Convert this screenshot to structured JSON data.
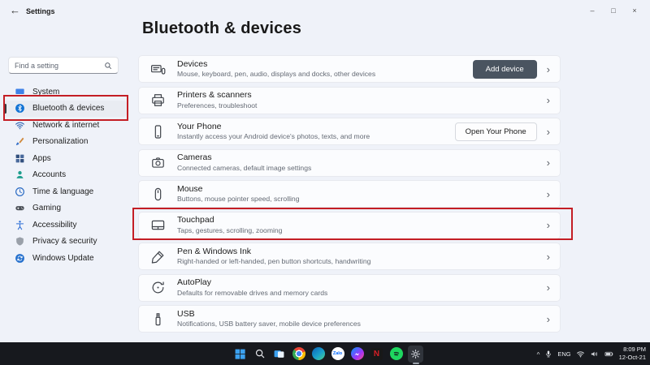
{
  "titlebar": {
    "app_title": "Settings",
    "back_glyph": "←",
    "minimize_glyph": "–",
    "maximize_glyph": "□",
    "close_glyph": "×"
  },
  "sidebar": {
    "search_placeholder": "Find a setting",
    "items": [
      {
        "label": "System"
      },
      {
        "label": "Bluetooth & devices",
        "selected": true
      },
      {
        "label": "Network & internet"
      },
      {
        "label": "Personalization"
      },
      {
        "label": "Apps"
      },
      {
        "label": "Accounts"
      },
      {
        "label": "Time & language"
      },
      {
        "label": "Gaming"
      },
      {
        "label": "Accessibility"
      },
      {
        "label": "Privacy & security"
      },
      {
        "label": "Windows Update"
      }
    ]
  },
  "page": {
    "title": "Bluetooth & devices"
  },
  "chevron_glyph": "›",
  "settings_rows": [
    {
      "title": "Devices",
      "subtitle": "Mouse, keyboard, pen, audio, displays and docks, other devices",
      "action": "Add device"
    },
    {
      "title": "Printers & scanners",
      "subtitle": "Preferences, troubleshoot"
    },
    {
      "title": "Your Phone",
      "subtitle": "Instantly access your Android device's photos, texts, and more",
      "action": "Open Your Phone"
    },
    {
      "title": "Cameras",
      "subtitle": "Connected cameras, default image settings"
    },
    {
      "title": "Mouse",
      "subtitle": "Buttons, mouse pointer speed, scrolling"
    },
    {
      "title": "Touchpad",
      "subtitle": "Taps, gestures, scrolling, zooming"
    },
    {
      "title": "Pen & Windows Ink",
      "subtitle": "Right-handed or left-handed, pen button shortcuts, handwriting"
    },
    {
      "title": "AutoPlay",
      "subtitle": "Defaults for removable drives and memory cards"
    },
    {
      "title": "USB",
      "subtitle": "Notifications, USB battery saver, mobile device preferences"
    }
  ],
  "annotations": {
    "highlight_color": "#c41e25",
    "highlighted_sidebar_item": "Bluetooth & devices",
    "highlighted_row": "Touchpad"
  },
  "taskbar": {
    "zalo_label": "Zalo",
    "netflix_label": "N",
    "hidden_icons_glyph": "^",
    "tray": {
      "language": "ENG",
      "time": "8:09 PM",
      "date": "12-Oct-21"
    }
  }
}
